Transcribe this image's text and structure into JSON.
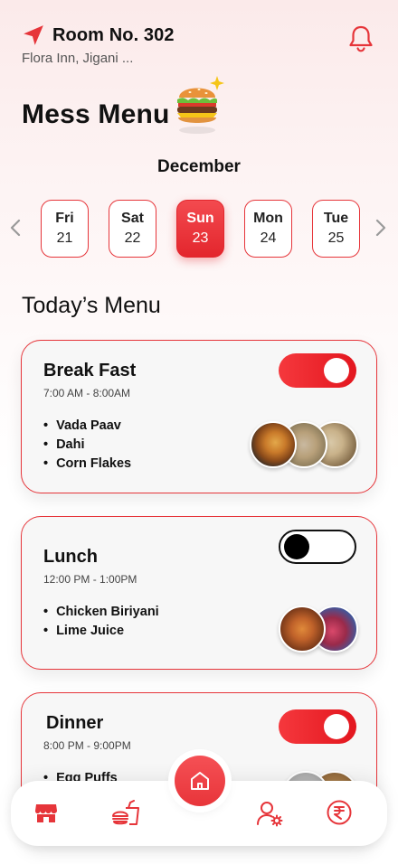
{
  "header": {
    "room": "Room No. 302",
    "hotel": "Flora Inn, Jigani ..."
  },
  "page_title": "Mess Menu",
  "month": "December",
  "dates": [
    {
      "day": "Fri",
      "num": "21",
      "active": false
    },
    {
      "day": "Sat",
      "num": "22",
      "active": false
    },
    {
      "day": "Sun",
      "num": "23",
      "active": true
    },
    {
      "day": "Mon",
      "num": "24",
      "active": false
    },
    {
      "day": "Tue",
      "num": "25",
      "active": false
    }
  ],
  "section_title": "Today’s Menu",
  "meals": {
    "breakfast": {
      "title": "Break Fast",
      "time": "7:00 AM - 8:00AM",
      "enabled": true,
      "items": [
        "Vada Paav",
        "Dahi",
        "Corn Flakes"
      ]
    },
    "lunch": {
      "title": "Lunch",
      "time": "12:00 PM - 1:00PM",
      "enabled": false,
      "items": [
        "Chicken Biriyani",
        "Lime Juice"
      ]
    },
    "dinner": {
      "title": "Dinner",
      "time": "8:00 PM - 9:00PM",
      "enabled": true,
      "items": [
        "Egg Puffs"
      ]
    }
  },
  "colors": {
    "accent": "#e6353a",
    "accent_dark": "#e3161e",
    "card_bg": "#f7f7f7"
  },
  "nav": {
    "icons": [
      "store-icon",
      "burger-drink-icon",
      "home-icon",
      "user-settings-icon",
      "rupee-icon"
    ]
  }
}
